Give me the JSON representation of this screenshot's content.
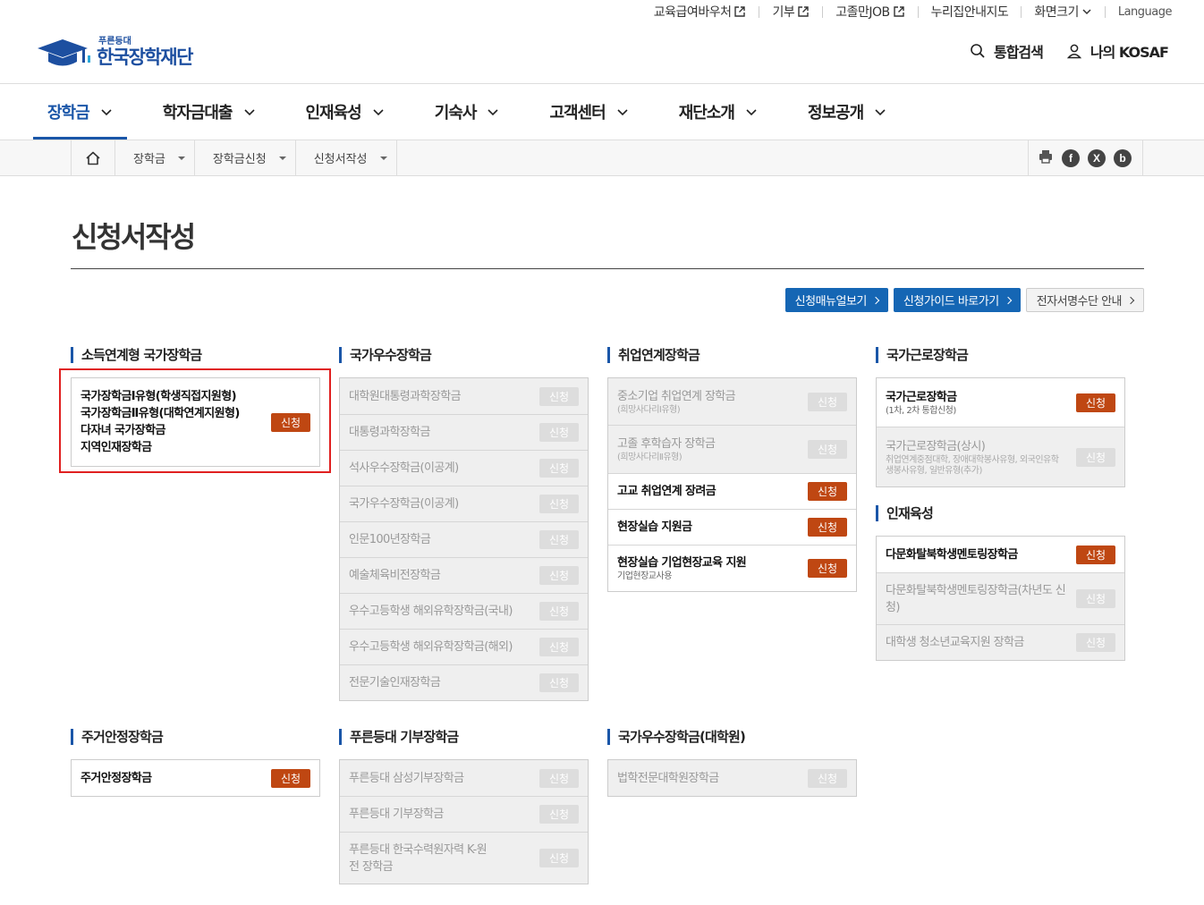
{
  "util_links": [
    {
      "label": "교육급여바우처",
      "external": true
    },
    {
      "label": "기부",
      "external": true
    },
    {
      "label": "고졸만JOB",
      "external": true
    },
    {
      "label": "누리집안내지도",
      "external": false
    }
  ],
  "util_font_size": "화면크기",
  "util_language": "Language",
  "logo": {
    "small": "푸른등대",
    "big": "한국장학재단"
  },
  "header": {
    "search": "통합검색",
    "my": "나의 KOSAF"
  },
  "gnb": [
    "장학금",
    "학자금대출",
    "인재육성",
    "기숙사",
    "고객센터",
    "재단소개",
    "정보공개"
  ],
  "breadcrumb": [
    "장학금",
    "장학금신청",
    "신청서작성"
  ],
  "share": {
    "facebook": "f",
    "x": "X",
    "blog": "b"
  },
  "page_title": "신청서작성",
  "buttons": {
    "manual": "신청매뉴얼보기",
    "guide": "신청가이드 바로가기",
    "cert": "전자서명수단 안내"
  },
  "apply_label": "신청",
  "sections": {
    "s1": {
      "title": "소득연계형 국가장학금",
      "items": [
        {
          "lines": [
            "국가장학금Ⅰ유형(학생직접지원형)",
            "국가장학금Ⅱ유형(대학연계지원형)",
            "다자녀 국가장학금",
            "지역인재장학금"
          ],
          "active": true
        }
      ]
    },
    "s2": {
      "title": "국가우수장학금",
      "items": [
        {
          "name": "대학원대통령과학장학금",
          "active": false
        },
        {
          "name": "대통령과학장학금",
          "active": false
        },
        {
          "name": "석사우수장학금(이공계)",
          "active": false
        },
        {
          "name": "국가우수장학금(이공계)",
          "active": false
        },
        {
          "name": "인문100년장학금",
          "active": false
        },
        {
          "name": "예술체육비전장학금",
          "active": false
        },
        {
          "name": "우수고등학생 해외유학장학금(국내)",
          "active": false
        },
        {
          "name": "우수고등학생 해외유학장학금(해외)",
          "active": false
        },
        {
          "name": "전문기술인재장학금",
          "active": false
        }
      ]
    },
    "s3": {
      "title": "취업연계장학금",
      "items": [
        {
          "name": "중소기업 취업연계 장학금",
          "sub": "(희망사다리Ⅰ유형)",
          "active": false
        },
        {
          "name": "고졸 후학습자 장학금",
          "sub": "(희망사다리Ⅱ유형)",
          "active": false
        },
        {
          "name": "고교 취업연계 장려금",
          "active": true
        },
        {
          "name": "현장실습 지원금",
          "active": true
        },
        {
          "name": "현장실습 기업현장교육 지원",
          "sub": "기업현장교사용",
          "active": true
        }
      ]
    },
    "s4": {
      "title": "국가근로장학금",
      "items": [
        {
          "name": "국가근로장학금",
          "sub": "(1차, 2차 통합신청)",
          "active": true
        },
        {
          "name": "국가근로장학금(상시)",
          "sub": "취업연계중점대학, 장애대학봉사유형, 외국인유학생봉사유형, 일반유형(추가)",
          "active": false
        }
      ]
    },
    "s5": {
      "title": "인재육성",
      "items": [
        {
          "name": "다문화탈북학생멘토링장학금",
          "active": true
        },
        {
          "name": "다문화탈북학생멘토링장학금(차년도 신청)",
          "active": false
        },
        {
          "name": "대학생 청소년교육지원 장학금",
          "active": false
        }
      ]
    },
    "s6": {
      "title": "주거안정장학금",
      "items": [
        {
          "name": "주거안정장학금",
          "active": true
        }
      ]
    },
    "s7": {
      "title": "푸른등대 기부장학금",
      "items": [
        {
          "name": "푸른등대 삼성기부장학금",
          "active": false
        },
        {
          "name": "푸른등대 기부장학금",
          "active": false
        },
        {
          "name": "푸른등대 한국수력원자력 K-원전 장학금",
          "active": false
        }
      ]
    },
    "s8": {
      "title": "국가우수장학금(대학원)",
      "items": [
        {
          "name": "법학전문대학원장학금",
          "active": false
        }
      ]
    }
  },
  "colors": {
    "primary": "#1a56a8",
    "apply": "#bf4712",
    "highlight": "#e02020"
  }
}
